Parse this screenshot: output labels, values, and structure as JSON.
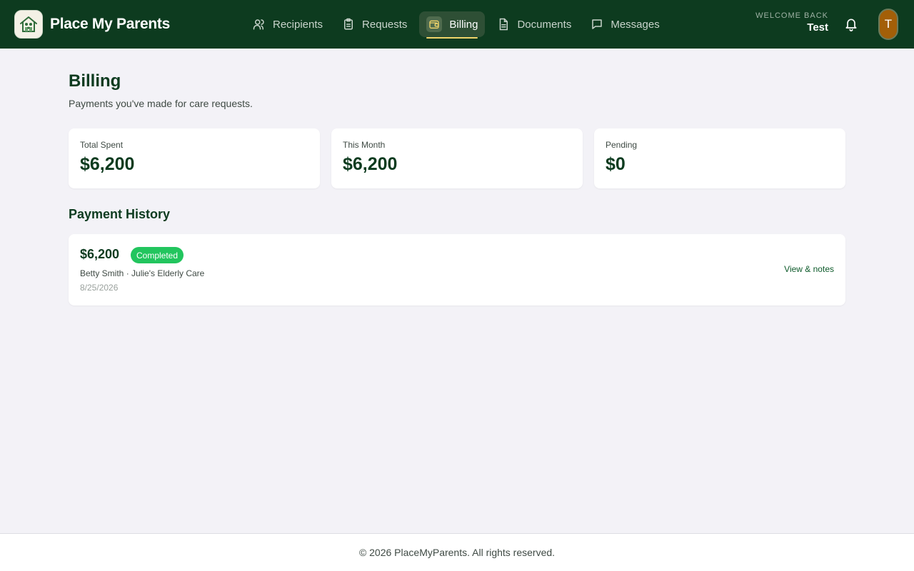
{
  "header": {
    "brand_name": "Place My Parents",
    "nav": [
      {
        "label": "Recipients",
        "icon": "users-icon"
      },
      {
        "label": "Requests",
        "icon": "clipboard-icon"
      },
      {
        "label": "Billing",
        "icon": "wallet-icon",
        "active": true
      },
      {
        "label": "Documents",
        "icon": "document-icon"
      },
      {
        "label": "Messages",
        "icon": "message-icon"
      }
    ],
    "welcome_label": "WELCOME BACK",
    "user_name": "Test",
    "avatar_initial": "T"
  },
  "main": {
    "title": "Billing",
    "subtitle": "Payments you've made for care requests.",
    "stats": [
      {
        "label": "Total Spent",
        "value": "$6,200"
      },
      {
        "label": "This Month",
        "value": "$6,200"
      },
      {
        "label": "Pending",
        "value": "$0"
      }
    ],
    "history_title": "Payment History",
    "payments": [
      {
        "amount": "$6,200",
        "status": "Completed",
        "description": "Betty Smith · Julie's Elderly Care",
        "date": "8/25/2026",
        "link": "View & notes"
      }
    ]
  },
  "footer": {
    "text": "© 2026 PlaceMyParents. All rights reserved."
  },
  "colors": {
    "header_bg": "#0d3b1f",
    "accent_underline": "#f0d46a",
    "status_completed": "#22c55e",
    "avatar_bg": "#a35f08",
    "page_bg": "#f3f2f7"
  }
}
